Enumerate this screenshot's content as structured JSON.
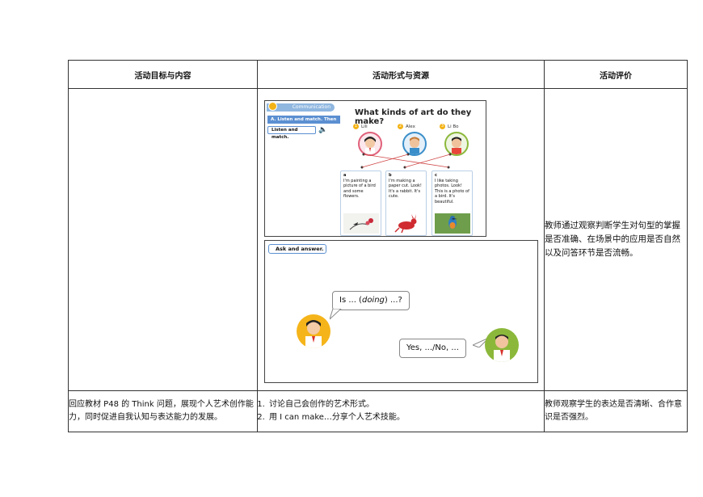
{
  "table": {
    "headers": [
      "活动目标与内容",
      "活动形式与资源",
      "活动评价"
    ],
    "row1": {
      "evaluation": "教师通过观察判断学生对句型的掌握是否准确、在场景中的应用是否自然以及问答环节是否流畅。"
    },
    "row2": {
      "goal": "回应教材 P48 的 Think 问题，展现个人艺术创作能力，同时促进自我认知与表达能力的发展。",
      "steps": [
        "讨论自己会创作的艺术形式。",
        "用 I can make…分享个人艺术技能。"
      ],
      "evaluation": "教师观察学生的表达是否清晰、合作意识是否强烈。"
    }
  },
  "panel1": {
    "section": "Communication",
    "task_a": "A. Listen and match. Then talk.",
    "task_b": "Listen and match.",
    "title": "What kinds of art do they make?",
    "kids": [
      {
        "num": "1",
        "name": "Lili"
      },
      {
        "num": "2",
        "name": "Alex"
      },
      {
        "num": "3",
        "name": "Li Bo"
      }
    ],
    "cards": [
      {
        "letter": "a",
        "text": "I'm painting a picture of a bird and some flowers."
      },
      {
        "letter": "b",
        "text": "I'm making a paper cut. Look! It's a rabbit. It's cute."
      },
      {
        "letter": "c",
        "text": "I like taking photos. Look! This is a photo of a bird. It's beautiful."
      }
    ],
    "colors": {
      "ring1": "#e0607a",
      "ring2": "#3a8ec9",
      "ring3": "#8bb83a",
      "line": "#d04545"
    }
  },
  "panel2": {
    "task": "Ask and answer.",
    "question_pre": "Is ... (",
    "question_verb": "doing",
    "question_post": ") ...?",
    "answer": "Yes, .../No, ..."
  }
}
